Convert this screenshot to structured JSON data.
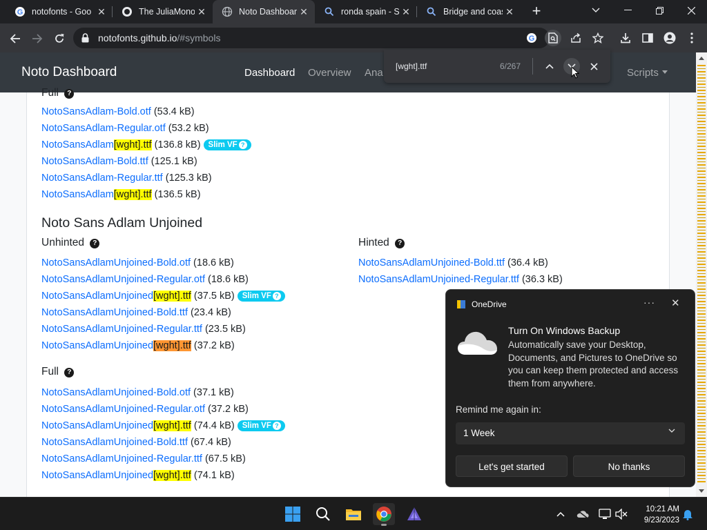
{
  "browser": {
    "tabs": [
      {
        "title": "notofonts - Goo",
        "icon": "google-icon"
      },
      {
        "title": "The JuliaMono T",
        "icon": "github-icon"
      },
      {
        "title": "Noto Dashboard",
        "icon": "globe-icon"
      },
      {
        "title": "ronda spain - Se",
        "icon": "search-icon"
      },
      {
        "title": "Bridge and coas",
        "icon": "search-icon"
      }
    ],
    "active_tab_index": 2,
    "url_host": "notofonts.github.io",
    "url_path": "/#symbols"
  },
  "find_bar": {
    "query": "[wght].ttf",
    "count": "6/267"
  },
  "page": {
    "brand": "Noto Dashboard",
    "nav": {
      "dashboard": "Dashboard",
      "overview": "Overview",
      "analyses": "Ana",
      "scripts": "Scripts"
    },
    "adlam_full_heading": "Full",
    "adlam_full_files": [
      {
        "name": "NotoSansAdlam-Bold.otf",
        "size": "(53.4 kB)"
      },
      {
        "name": "NotoSansAdlam-Regular.otf",
        "size": "(53.2 kB)"
      },
      {
        "prefix": "NotoSansAdlam",
        "match": "[wght].ttf",
        "size": "(136.8 kB)",
        "badge": "Slim VF"
      },
      {
        "name": "NotoSansAdlam-Bold.ttf",
        "size": "(125.1 kB)"
      },
      {
        "name": "NotoSansAdlam-Regular.ttf",
        "size": "(125.3 kB)"
      },
      {
        "prefix": "NotoSansAdlam",
        "match": "[wght].ttf",
        "size": "(136.5 kB)"
      }
    ],
    "unjoined_title": "Noto Sans Adlam Unjoined",
    "unhinted_heading": "Unhinted",
    "hinted_heading": "Hinted",
    "full_heading": "Full",
    "unhinted_files": [
      {
        "name": "NotoSansAdlamUnjoined-Bold.otf",
        "size": "(18.6 kB)"
      },
      {
        "name": "NotoSansAdlamUnjoined-Regular.otf",
        "size": "(18.6 kB)"
      },
      {
        "prefix": "NotoSansAdlamUnjoined",
        "match": "[wght].ttf",
        "size": "(37.5 kB)",
        "badge": "Slim VF"
      },
      {
        "name": "NotoSansAdlamUnjoined-Bold.ttf",
        "size": "(23.4 kB)"
      },
      {
        "name": "NotoSansAdlamUnjoined-Regular.ttf",
        "size": "(23.5 kB)"
      },
      {
        "prefix": "NotoSansAdlamUnjoined",
        "match": "[wght].ttf",
        "size": "(37.2 kB)"
      }
    ],
    "hinted_files": [
      {
        "name": "NotoSansAdlamUnjoined-Bold.ttf",
        "size": "(36.4 kB)"
      },
      {
        "name": "NotoSansAdlamUnjoined-Regular.ttf",
        "size": "(36.3 kB)"
      }
    ],
    "full_files": [
      {
        "name": "NotoSansAdlamUnjoined-Bold.otf",
        "size": "(37.1 kB)"
      },
      {
        "name": "NotoSansAdlamUnjoined-Regular.otf",
        "size": "(37.2 kB)"
      },
      {
        "prefix": "NotoSansAdlamUnjoined",
        "match": "[wght].ttf",
        "size": "(74.4 kB)",
        "badge": "Slim VF"
      },
      {
        "name": "NotoSansAdlamUnjoined-Bold.ttf",
        "size": "(67.4 kB)"
      },
      {
        "name": "NotoSansAdlamUnjoined-Regular.ttf",
        "size": "(67.5 kB)"
      },
      {
        "prefix": "NotoSansAdlamUnjoined",
        "match": "[wght].ttf",
        "size": "(74.1 kB)"
      }
    ]
  },
  "toast": {
    "app": "OneDrive",
    "dots": "···",
    "title": "Turn On Windows Backup",
    "body": "Automatically save your Desktop, Documents, and Pictures to OneDrive so you can keep them protected and access them from anywhere.",
    "remind_label": "Remind me again in:",
    "remind_value": "1 Week",
    "primary_button": "Let's get started",
    "secondary_button": "No thanks"
  },
  "taskbar": {
    "time": "10:21 AM",
    "date": "9/23/2023",
    "apps": [
      "start-icon",
      "search-icon",
      "file-explorer-icon",
      "chrome-icon",
      "julia-app-icon"
    ]
  },
  "colors": {
    "link": "#0d6efd",
    "highlight": "#ffff00",
    "current_highlight": "#ff9632",
    "badge": "#0dcaf0",
    "navbar": "#343a40"
  }
}
